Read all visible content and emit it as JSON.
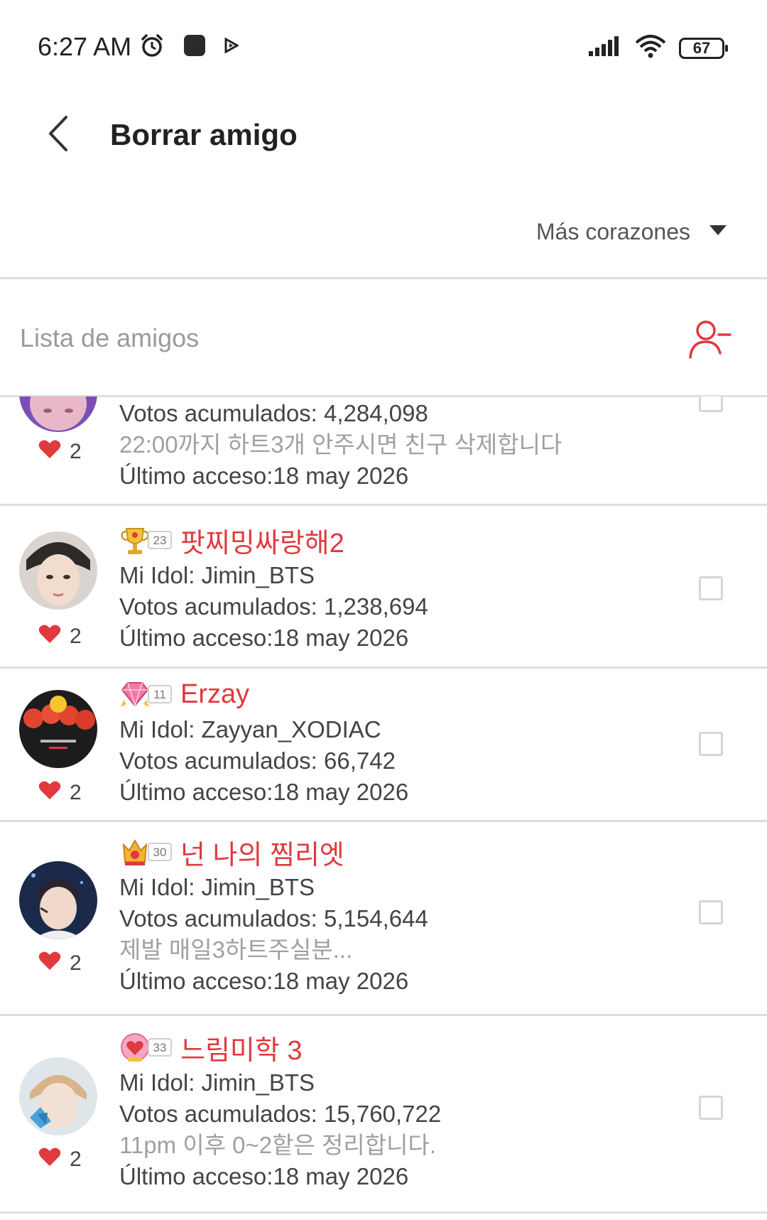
{
  "status_bar": {
    "time": "6:27 AM",
    "battery": "67",
    "icons": [
      "alarm-icon",
      "app-square-icon",
      "play-icon",
      "signal-icon",
      "wifi-icon",
      "battery-icon"
    ]
  },
  "header": {
    "title": "Borrar amigo"
  },
  "sort": {
    "label": "Más corazones"
  },
  "list_header": {
    "title": "Lista de amigos"
  },
  "colors": {
    "accent": "#e0393e",
    "divider": "#dedede",
    "muted_text": "#a0a0a0"
  },
  "friends": [
    {
      "name": "",
      "badge_level": "",
      "idol": "",
      "votes": "Votos acumulados: 4,284,098",
      "message": "22:00까지  하트3개 안주시면 친구 삭제합니다",
      "last_access": "Último acceso:18 may 2026",
      "hearts": "2"
    },
    {
      "name": "팟찌밍싸랑해2",
      "badge_level": "23",
      "idol": "Mi Idol: Jimin_BTS",
      "votes": "Votos acumulados: 1,238,694",
      "message": "",
      "last_access": "Último acceso:18 may 2026",
      "hearts": "2"
    },
    {
      "name": "Erzay",
      "badge_level": "11",
      "idol": "Mi Idol: Zayyan_XODIAC",
      "votes": "Votos acumulados: 66,742",
      "message": "",
      "last_access": "Último acceso:18 may 2026",
      "hearts": "2"
    },
    {
      "name": "넌 나의 찜리엣",
      "badge_level": "30",
      "idol": "Mi Idol: Jimin_BTS",
      "votes": "Votos acumulados: 5,154,644",
      "message": "제발 매일3하트주실분...",
      "last_access": "Último acceso:18 may 2026",
      "hearts": "2"
    },
    {
      "name": "느림미학 3",
      "badge_level": "33",
      "idol": "Mi Idol: Jimin_BTS",
      "votes": "Votos acumulados: 15,760,722",
      "message": "11pm 이후 0~2핱은 정리합니다.",
      "last_access": "Último acceso:18 may 2026",
      "hearts": "2"
    }
  ]
}
